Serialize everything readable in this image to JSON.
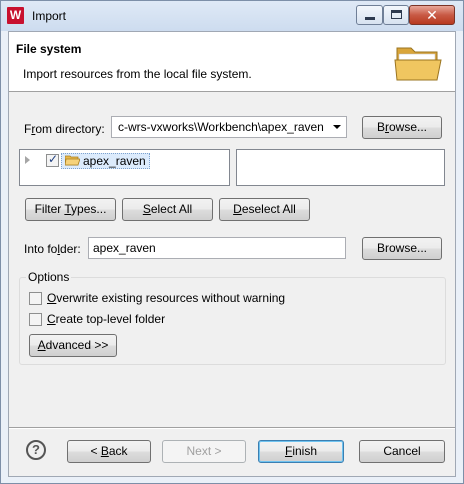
{
  "window": {
    "title": "Import",
    "app_icon_letter": "W",
    "close_symbol": "✕"
  },
  "header": {
    "title": "File system",
    "description": "Import resources from the local file system."
  },
  "from_directory": {
    "label_pre": "F",
    "label_mn": "r",
    "label_post": "om directory:",
    "value": "c-wrs-vxworks\\Workbench\\apex_raven",
    "browse_pre": "B",
    "browse_mn": "r",
    "browse_post": "owse..."
  },
  "tree": {
    "items": [
      {
        "label": "apex_raven",
        "checked": true
      }
    ]
  },
  "selection_buttons": {
    "filter_types_pre": "Filter ",
    "filter_types_mn": "T",
    "filter_types_post": "ypes...",
    "select_all_mn": "S",
    "select_all_post": "elect All",
    "deselect_all_mn": "D",
    "deselect_all_post": "eselect All"
  },
  "into_folder": {
    "label_pre": "Into fo",
    "label_mn": "l",
    "label_post": "der:",
    "value": "apex_raven",
    "browse": "Browse..."
  },
  "options": {
    "title": "Options",
    "overwrite_mn": "O",
    "overwrite_post": "verwrite existing resources without warning",
    "overwrite_checked": false,
    "top_level_mn": "C",
    "top_level_post": "reate top-level folder",
    "top_level_checked": false,
    "advanced_mn": "A",
    "advanced_post": "dvanced >>"
  },
  "footer": {
    "help_symbol": "?",
    "back_pre": "< ",
    "back_mn": "B",
    "back_post": "ack",
    "next": "Next >",
    "finish_mn": "F",
    "finish_post": "inish",
    "cancel": "Cancel"
  },
  "colors": {
    "accent": "#3c7fb1",
    "app_icon": "#c8102e",
    "folder": "#e8b84a"
  }
}
